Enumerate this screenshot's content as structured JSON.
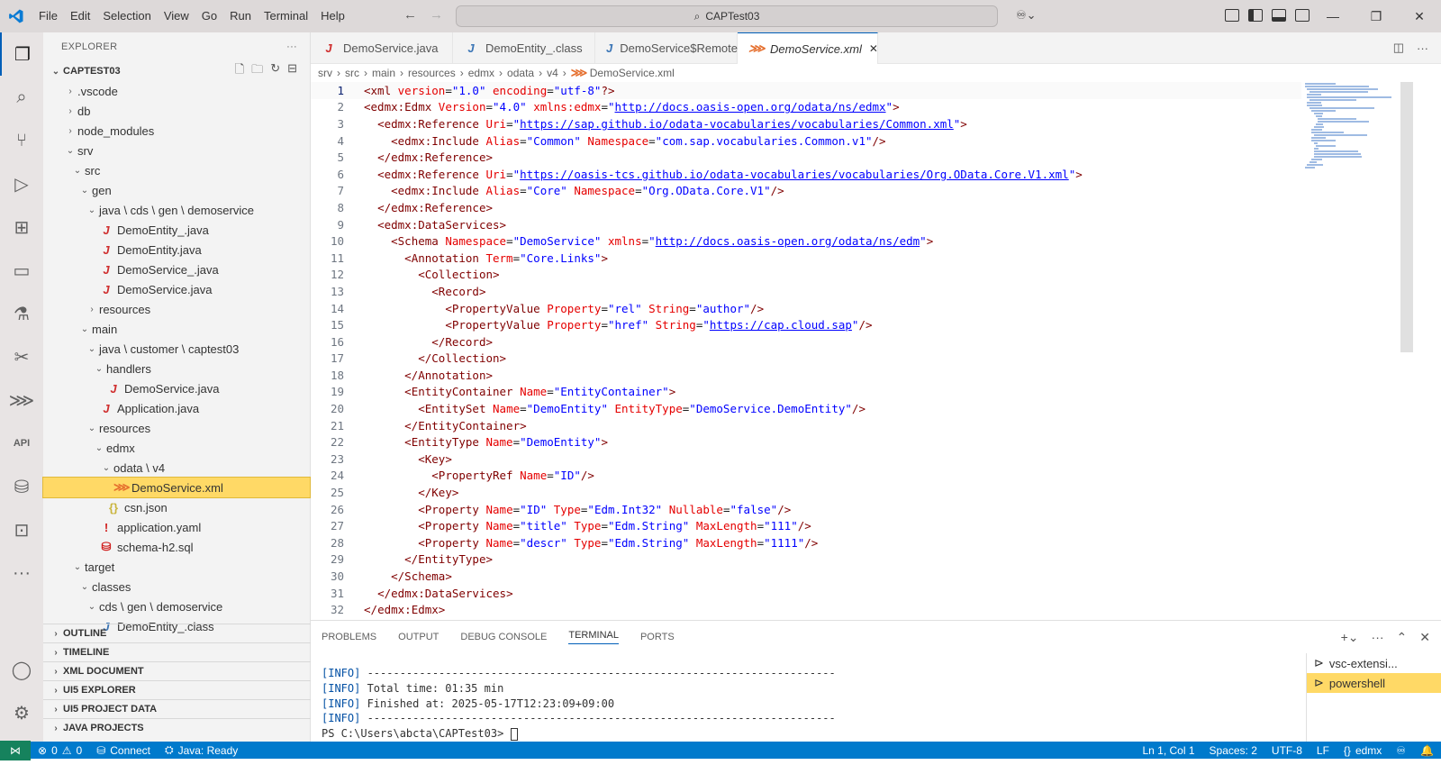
{
  "titlebar": {
    "menus": [
      "File",
      "Edit",
      "Selection",
      "View",
      "Go",
      "Run",
      "Terminal",
      "Help"
    ],
    "search_text": "CAPTest03"
  },
  "explorer": {
    "title": "EXPLORER",
    "project": "CAPTEST03",
    "tree": [
      {
        "label": ".vscode",
        "depth": 1,
        "kind": "folder",
        "open": false
      },
      {
        "label": "db",
        "depth": 1,
        "kind": "folder",
        "open": false
      },
      {
        "label": "node_modules",
        "depth": 1,
        "kind": "folder",
        "open": false
      },
      {
        "label": "srv",
        "depth": 1,
        "kind": "folder",
        "open": true
      },
      {
        "label": "src",
        "depth": 2,
        "kind": "folder",
        "open": true
      },
      {
        "label": "gen",
        "depth": 3,
        "kind": "folder",
        "open": true
      },
      {
        "label": "java \\ cds \\ gen \\ demoservice",
        "depth": 4,
        "kind": "folder",
        "open": true
      },
      {
        "label": "DemoEntity_.java",
        "depth": 5,
        "kind": "java"
      },
      {
        "label": "DemoEntity.java",
        "depth": 5,
        "kind": "java"
      },
      {
        "label": "DemoService_.java",
        "depth": 5,
        "kind": "java"
      },
      {
        "label": "DemoService.java",
        "depth": 5,
        "kind": "java"
      },
      {
        "label": "resources",
        "depth": 4,
        "kind": "folder",
        "open": false
      },
      {
        "label": "main",
        "depth": 3,
        "kind": "folder",
        "open": true
      },
      {
        "label": "java \\ customer \\ captest03",
        "depth": 4,
        "kind": "folder",
        "open": true
      },
      {
        "label": "handlers",
        "depth": 5,
        "kind": "folder",
        "open": true
      },
      {
        "label": "DemoService.java",
        "depth": 6,
        "kind": "java"
      },
      {
        "label": "Application.java",
        "depth": 5,
        "kind": "java"
      },
      {
        "label": "resources",
        "depth": 4,
        "kind": "folder",
        "open": true
      },
      {
        "label": "edmx",
        "depth": 5,
        "kind": "folder",
        "open": true
      },
      {
        "label": "odata \\ v4",
        "depth": 6,
        "kind": "folder",
        "open": true
      },
      {
        "label": "DemoService.xml",
        "depth": 7,
        "kind": "xml",
        "selected": true
      },
      {
        "label": "csn.json",
        "depth": 6,
        "kind": "json"
      },
      {
        "label": "application.yaml",
        "depth": 5,
        "kind": "yaml"
      },
      {
        "label": "schema-h2.sql",
        "depth": 5,
        "kind": "sql"
      },
      {
        "label": "target",
        "depth": 2,
        "kind": "folder",
        "open": true
      },
      {
        "label": "classes",
        "depth": 3,
        "kind": "folder",
        "open": true
      },
      {
        "label": "cds \\ gen \\ demoservice",
        "depth": 4,
        "kind": "folder",
        "open": true
      },
      {
        "label": "DemoEntity_.class",
        "depth": 5,
        "kind": "class"
      }
    ],
    "sections": [
      "OUTLINE",
      "TIMELINE",
      "XML DOCUMENT",
      "UI5 EXPLORER",
      "UI5 PROJECT DATA",
      "JAVA PROJECTS"
    ]
  },
  "tabs": [
    {
      "label": "DemoService.java",
      "kind": "java"
    },
    {
      "label": "DemoEntity_.class",
      "kind": "class"
    },
    {
      "label": "DemoService$Remote.class",
      "kind": "class"
    },
    {
      "label": "DemoService.xml",
      "kind": "xml",
      "active": true
    }
  ],
  "breadcrumb": [
    "srv",
    "src",
    "main",
    "resources",
    "edmx",
    "odata",
    "v4",
    "DemoService.xml"
  ],
  "code_lines": [
    "<?xml version=\"1.0\" encoding=\"utf-8\"?>",
    "<edmx:Edmx Version=\"4.0\" xmlns:edmx=\"http://docs.oasis-open.org/odata/ns/edmx\">",
    "  <edmx:Reference Uri=\"https://sap.github.io/odata-vocabularies/vocabularies/Common.xml\">",
    "    <edmx:Include Alias=\"Common\" Namespace=\"com.sap.vocabularies.Common.v1\"/>",
    "  </edmx:Reference>",
    "  <edmx:Reference Uri=\"https://oasis-tcs.github.io/odata-vocabularies/vocabularies/Org.OData.Core.V1.xml\">",
    "    <edmx:Include Alias=\"Core\" Namespace=\"Org.OData.Core.V1\"/>",
    "  </edmx:Reference>",
    "  <edmx:DataServices>",
    "    <Schema Namespace=\"DemoService\" xmlns=\"http://docs.oasis-open.org/odata/ns/edm\">",
    "      <Annotation Term=\"Core.Links\">",
    "        <Collection>",
    "          <Record>",
    "            <PropertyValue Property=\"rel\" String=\"author\"/>",
    "            <PropertyValue Property=\"href\" String=\"https://cap.cloud.sap\"/>",
    "          </Record>",
    "        </Collection>",
    "      </Annotation>",
    "      <EntityContainer Name=\"EntityContainer\">",
    "        <EntitySet Name=\"DemoEntity\" EntityType=\"DemoService.DemoEntity\"/>",
    "      </EntityContainer>",
    "      <EntityType Name=\"DemoEntity\">",
    "        <Key>",
    "          <PropertyRef Name=\"ID\"/>",
    "        </Key>",
    "        <Property Name=\"ID\" Type=\"Edm.Int32\" Nullable=\"false\"/>",
    "        <Property Name=\"title\" Type=\"Edm.String\" MaxLength=\"111\"/>",
    "        <Property Name=\"descr\" Type=\"Edm.String\" MaxLength=\"1111\"/>",
    "      </EntityType>",
    "    </Schema>",
    "  </edmx:DataServices>",
    "</edmx:Edmx>"
  ],
  "panel": {
    "tabs": [
      "PROBLEMS",
      "OUTPUT",
      "DEBUG CONSOLE",
      "TERMINAL",
      "PORTS"
    ],
    "active_tab": "TERMINAL",
    "terminal_lines": [
      {
        "tag": "[INFO]",
        "text": " ------------------------------------------------------------------------"
      },
      {
        "tag": "[INFO]",
        "text": " Total time:  01:35 min"
      },
      {
        "tag": "[INFO]",
        "text": " Finished at: 2025-05-17T12:23:09+09:00"
      },
      {
        "tag": "[INFO]",
        "text": " ------------------------------------------------------------------------"
      }
    ],
    "prompt": "PS C:\\Users\\abcta\\CAPTest03> ",
    "terminals": [
      "vsc-extensi...",
      "powershell"
    ]
  },
  "status": {
    "errors": "0",
    "warnings": "0",
    "connect": "Connect",
    "java": "Java: Ready",
    "position": "Ln 1, Col 1",
    "spaces": "Spaces: 2",
    "encoding": "UTF-8",
    "eol": "LF",
    "language": "edmx"
  }
}
